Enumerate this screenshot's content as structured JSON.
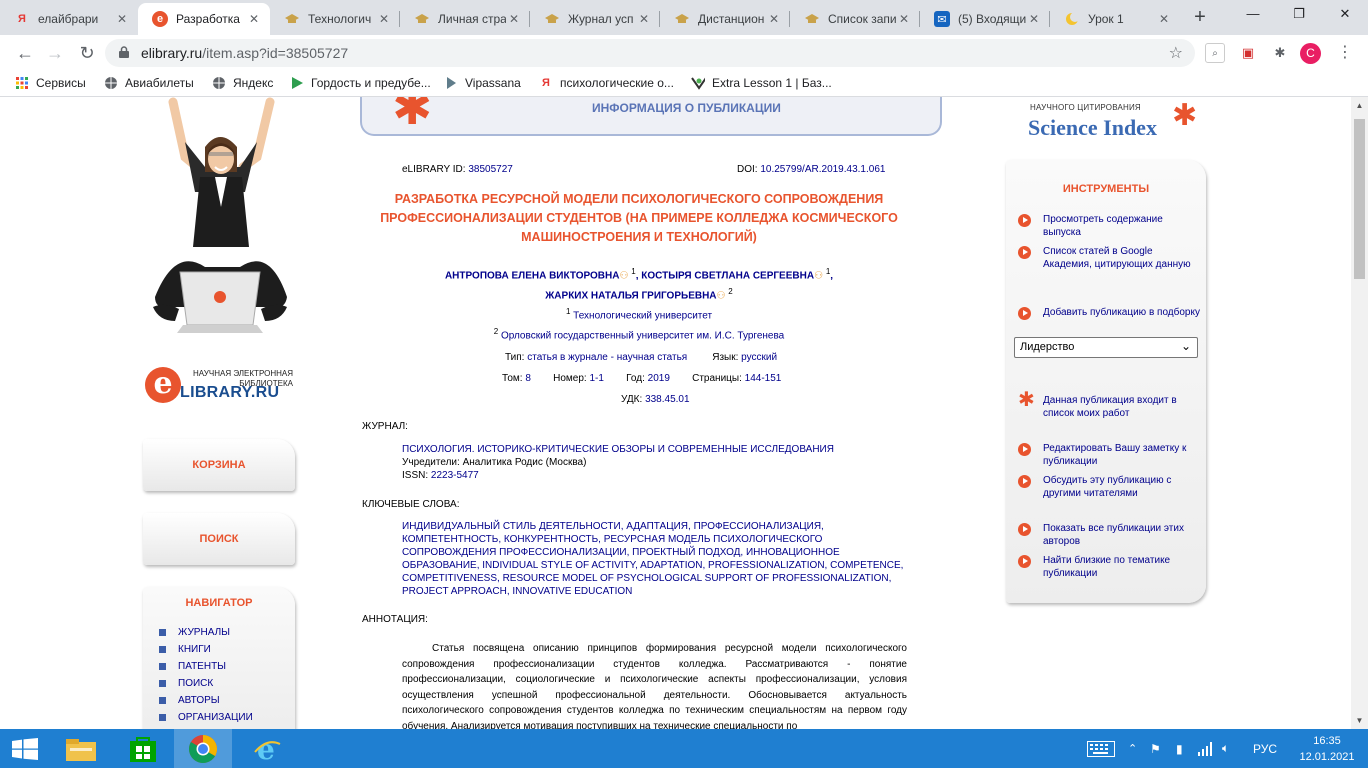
{
  "browser": {
    "tabs": [
      {
        "icon_letter": "Я",
        "title": "елайбрари",
        "active": false
      },
      {
        "icon_letter": "e",
        "title": "Разработка",
        "active": true
      },
      {
        "icon_letter": "",
        "title": "Технологич",
        "active": false
      },
      {
        "icon_letter": "",
        "title": "Личная стра",
        "active": false
      },
      {
        "icon_letter": "",
        "title": "Журнал усп",
        "active": false
      },
      {
        "icon_letter": "",
        "title": "Дистанцион",
        "active": false
      },
      {
        "icon_letter": "",
        "title": "Список запи",
        "active": false
      },
      {
        "icon_letter": "",
        "title": "(5) Входящи",
        "active": false
      },
      {
        "icon_letter": "",
        "title": "Урок 1",
        "active": false
      }
    ],
    "new_tab": "+",
    "url_host": "elibrary.ru",
    "url_path": "/item.asp?id=38505727",
    "profile_letter": "C",
    "bookmarks": [
      {
        "icon": "grid-icon",
        "label": "Сервисы"
      },
      {
        "icon": "globe-icon",
        "label": "Авиабилеты"
      },
      {
        "icon": "globe-icon",
        "label": "Яндекс"
      },
      {
        "icon": "play-icon",
        "label": "Гордость и предубе..."
      },
      {
        "icon": "vipassana-icon",
        "label": "Vipassana"
      },
      {
        "icon": "yandex-icon",
        "label": "психологические о..."
      },
      {
        "icon": "extra-lesson-icon",
        "label": "Extra Lesson 1 | Баз..."
      }
    ]
  },
  "site": {
    "logo_sub": "НАУЧНАЯ ЭЛЕКТРОННАЯ БИБЛИОТЕКА",
    "logo_letter": "e",
    "logo_name": "LIBRARY.RU",
    "cart_label": "КОРЗИНА",
    "search_label": "ПОИСК",
    "navigator": {
      "title": "НАВИГАТОР",
      "items": [
        "ЖУРНАЛЫ",
        "КНИГИ",
        "ПАТЕНТЫ",
        "ПОИСК",
        "АВТОРЫ",
        "ОРГАНИЗАЦИИ"
      ]
    },
    "header_title": "ИНФОРМАЦИЯ О ПУБЛИКАЦИИ",
    "science_index": {
      "top": "НАУЧНОГО ЦИТИРОВАНИЯ",
      "name": "Science Index"
    }
  },
  "publication": {
    "id_label": "eLIBRARY ID:",
    "id_value": "38505727",
    "doi_label": "DOI:",
    "doi_value": "10.25799/AR.2019.43.1.061",
    "title": "РАЗРАБОТКА РЕСУРСНОЙ МОДЕЛИ ПСИХОЛОГИЧЕСКОГО СОПРОВОЖДЕНИЯ ПРОФЕССИОНАЛИЗАЦИИ СТУДЕНТОВ (НА ПРИМЕРЕ КОЛЛЕДЖА КОСМИЧЕСКОГО МАШИНОСТРОЕНИЯ И ТЕХНОЛОГИЙ)",
    "authors": [
      {
        "name": "АНТРОПОВА ЕЛЕНА ВИКТОРОВНА",
        "sup": "1",
        "sep": ","
      },
      {
        "name": "КОСТЫРЯ СВЕТЛАНА СЕРГЕЕВНА",
        "sup": "1",
        "sep": ","
      },
      {
        "name": "ЖАРКИХ НАТАЛЬЯ ГРИГОРЬЕВНА",
        "sup": "2",
        "sep": ""
      }
    ],
    "affiliations": [
      {
        "sup": "1",
        "name": "Технологический университет"
      },
      {
        "sup": "2",
        "name": "Орловский государственный университет им. И.С. Тургенева"
      }
    ],
    "type_label": "Тип:",
    "type_value": "статья в журнале - научная статья",
    "lang_label": "Язык:",
    "lang_value": "русский",
    "volume_label": "Том:",
    "volume_value": "8",
    "number_label": "Номер:",
    "number_value": "1-1",
    "year_label": "Год:",
    "year_value": "2019",
    "pages_label": "Страницы:",
    "pages_value": "144-151",
    "udk_label": "УДК:",
    "udk_value": "338.45.01",
    "journal_label": "ЖУРНАЛ:",
    "journal_name": "ПСИХОЛОГИЯ. ИСТОРИКО-КРИТИЧЕСКИЕ ОБЗОРЫ И СОВРЕМЕННЫЕ ИССЛЕДОВАНИЯ",
    "founders_label": "Учредители:",
    "founders_value": "Аналитика Родис (Москва)",
    "issn_label": "ISSN:",
    "issn_value": "2223-5477",
    "keywords_label": "КЛЮЧЕВЫЕ СЛОВА:",
    "keywords": "ИНДИВИДУАЛЬНЫЙ СТИЛЬ ДЕЯТЕЛЬНОСТИ, АДАПТАЦИЯ, ПРОФЕССИОНАЛИЗАЦИЯ, КОМПЕТЕНТНОСТЬ, КОНКУРЕНТНОСТЬ, РЕСУРСНАЯ МОДЕЛЬ ПСИХОЛОГИЧЕСКОГО СОПРОВОЖДЕНИЯ ПРОФЕССИОНАЛИЗАЦИИ, ПРОЕКТНЫЙ ПОДХОД, ИННОВАЦИОННОЕ ОБРАЗОВАНИЕ, INDIVIDUAL STYLE OF ACTIVITY, ADAPTATION, PROFESSIONALIZATION, COMPETENCE, COMPETITIVENESS, RESOURCE MODEL OF PSYCHOLOGICAL SUPPORT OF PROFESSIONALIZATION, PROJECT APPROACH, INNOVATIVE EDUCATION",
    "abstract_label": "АННОТАЦИЯ:",
    "abstract": "Статья посвящена описанию принципов формирования ресурсной модели психологического сопровождения профессионализации студентов колледжа. Рассматриваются - понятие профессионализации, социологические и психологические аспекты профессионализации, условия осуществления успешной профессиональной деятельности. Обосновывается актуальность психологического сопровождения студентов колледжа по техническим специальностям на первом году обучения. Анализируется мотивация поступивших на технические специальности по"
  },
  "tools": {
    "title": "ИНСТРУМЕНТЫ",
    "items": [
      {
        "kind": "dot",
        "label": "Просмотреть содержание выпуска"
      },
      {
        "kind": "dot",
        "label": "Список статей в Google Академия, цитирующих данную"
      },
      {
        "kind": "dot",
        "label": "Добавить публикацию в подборку"
      },
      {
        "kind": "star",
        "label": "Данная публикация входит в список моих работ"
      },
      {
        "kind": "dot",
        "label": "Редактировать Вашу заметку к публикации"
      },
      {
        "kind": "dot",
        "label": "Обсудить эту публикацию с другими читателями"
      },
      {
        "kind": "dot",
        "label": "Показать все публикации этих авторов"
      },
      {
        "kind": "dot",
        "label": "Найти близкие по тематике публикации"
      }
    ],
    "select_value": "Лидерство"
  },
  "taskbar": {
    "lang": "РУС",
    "time": "16:35",
    "date": "12.01.2021"
  },
  "colors": {
    "accent": "#e8542e",
    "link": "#00008b",
    "taskbar": "#1f7fd1"
  }
}
